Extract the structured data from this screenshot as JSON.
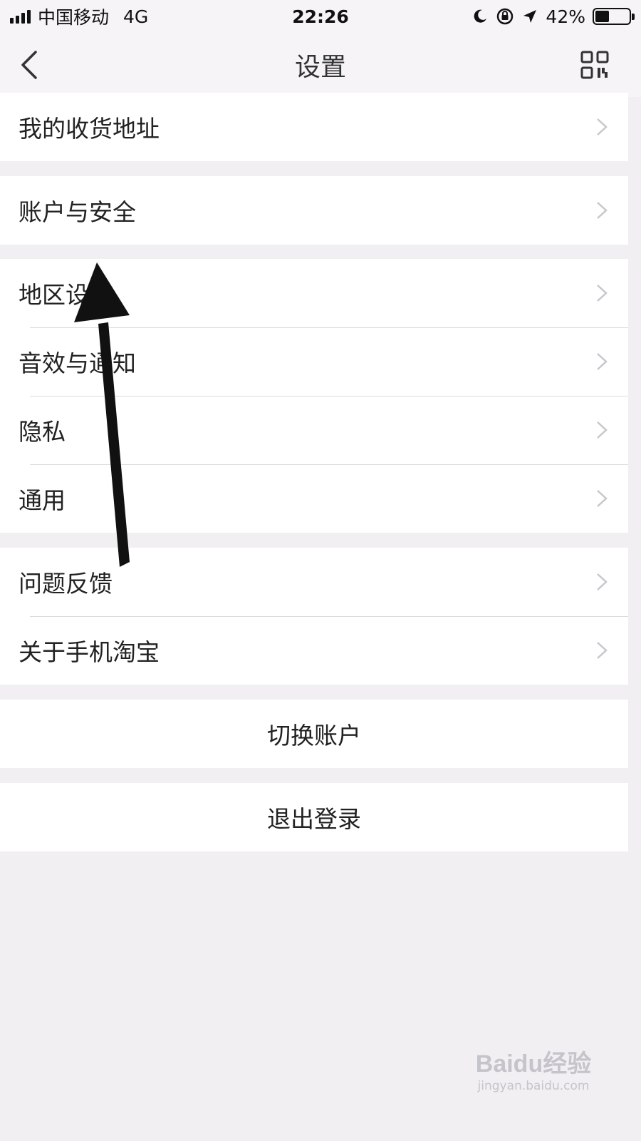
{
  "status_bar": {
    "carrier": "中国移动",
    "network": "4G",
    "time": "22:26",
    "battery_percent": "42%",
    "battery_level": 0.42,
    "icons": [
      "signal-bars-icon",
      "moon-icon",
      "orientation-lock-icon",
      "location-arrow-icon",
      "battery-icon"
    ]
  },
  "nav": {
    "title": "设置",
    "back_icon": "chevron-left-icon",
    "right_icon": "qr-code-icon"
  },
  "groups": [
    {
      "items": [
        {
          "label": "我的收货地址"
        }
      ]
    },
    {
      "items": [
        {
          "label": "账户与安全"
        }
      ]
    },
    {
      "items": [
        {
          "label": "地区设置"
        },
        {
          "label": "音效与通知"
        },
        {
          "label": "隐私"
        },
        {
          "label": "通用"
        }
      ]
    },
    {
      "items": [
        {
          "label": "问题反馈"
        },
        {
          "label": "关于手机淘宝"
        }
      ]
    }
  ],
  "actions": {
    "switch_account": "切换账户",
    "logout": "退出登录"
  },
  "watermark": {
    "logo": "Baidu经验",
    "url": "jingyan.baidu.com"
  },
  "colors": {
    "background": "#f2eff3",
    "row_background": "#ffffff",
    "chevron": "#c7c7cc",
    "annotation_arrow": "#111111"
  }
}
